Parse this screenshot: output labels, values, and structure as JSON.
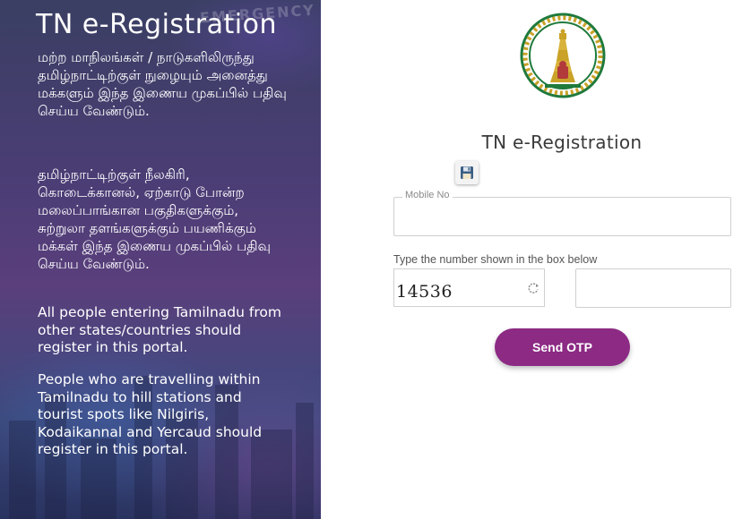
{
  "left": {
    "title": "TN e-Registration",
    "tamil_para_1": "மற்ற மாநிலங்கள் / நாடுகளிலிருந்து தமிழ்நாட்டிற்குள் நுழையும் அனைத்து மக்களும் இந்த இணைய முகப்பில் பதிவு செய்ய வேண்டும்.",
    "tamil_para_2": "தமிழ்நாட்டிற்குள் நீலகிரி, கொடைக்கானல், ஏற்காடு போன்ற மலைப்பாங்கான பகுதிகளுக்கும், சுற்றுலா தளங்களுக்கும் பயணிக்கும் மக்கள் இந்த இணைய முகப்பில் பதிவு செய்ய வேண்டும்.",
    "english_para_1": "All people entering Tamilnadu from other states/countries should register in this portal.",
    "english_para_2": "People who are travelling within Tamilnadu to hill stations and tourist spots like Nilgiris, Kodaikannal and Yercaud should register in this portal.",
    "background_sign": "EMERGENCY"
  },
  "form": {
    "title": "TN e-Registration",
    "mobile_label": "Mobile No",
    "mobile_value": "",
    "captcha_label": "Type the number shown in the box below",
    "captcha_code": "14536",
    "captcha_value": "",
    "send_otp_label": "Send OTP"
  },
  "icons": {
    "emblem": "tamil-nadu-emblem",
    "save": "floppy-disk-icon",
    "refresh": "refresh-icon"
  },
  "colors": {
    "accent": "#8c2a84",
    "emblem_green": "#1f7a3c",
    "emblem_gold": "#c9a227",
    "panel_dark": "#3a3f63"
  }
}
